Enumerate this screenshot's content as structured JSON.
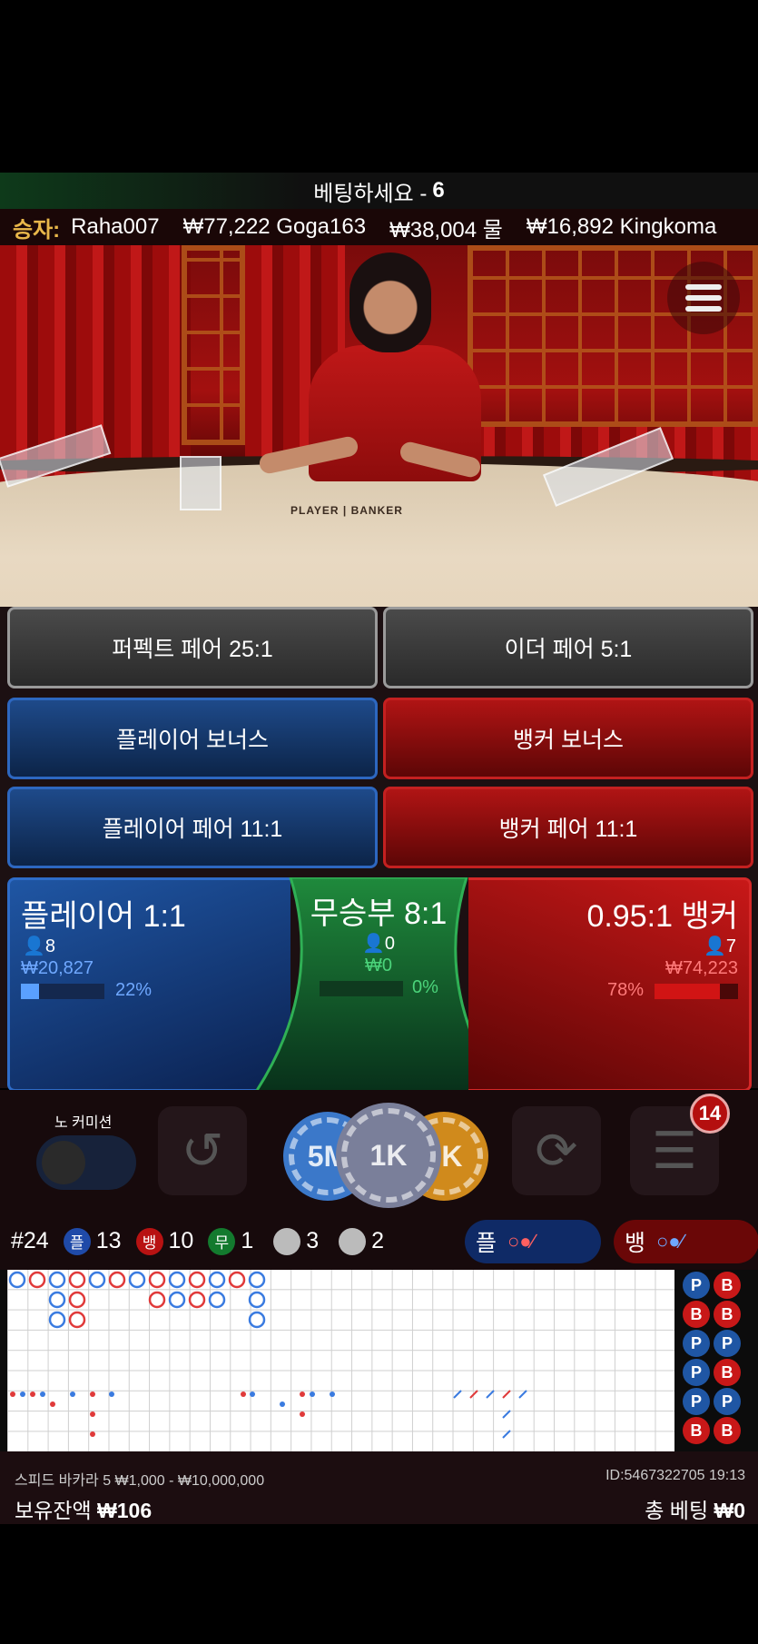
{
  "status": {
    "text": "베팅하세요 -",
    "count": "6"
  },
  "winners": {
    "label": "승자:",
    "items": [
      "Raha007",
      "₩77,222 Goga163",
      "₩38,004 물",
      "₩16,892 Kingkoma"
    ]
  },
  "video": {
    "table_text": "PLAYER | BANKER"
  },
  "side_bets": {
    "perfect_pair": "퍼펙트 페어 25:1",
    "either_pair": "이더 페어 5:1",
    "player_bonus": "플레이어 보너스",
    "banker_bonus": "뱅커 보너스",
    "player_pair": "플레이어 페어 11:1",
    "banker_pair": "뱅커 페어 11:1"
  },
  "main_bets": {
    "player": {
      "title": "플레이어 1:1",
      "players": "8",
      "amount": "₩20,827",
      "percent_label": "22%",
      "percent": 22
    },
    "tie": {
      "title": "무승부 8:1",
      "players": "0",
      "amount": "₩0",
      "percent_label": "0%",
      "percent": 0
    },
    "banker": {
      "title": "0.95:1 뱅커",
      "players": "7",
      "amount": "₩74,223",
      "percent_label": "78%",
      "percent": 78
    }
  },
  "controls": {
    "no_commission_label": "노 커미션",
    "chips": [
      "5M",
      "1K",
      "5K"
    ],
    "bet_history_count": "14"
  },
  "stats": {
    "round": "#24",
    "player_letter": "플",
    "player_wins": "13",
    "banker_letter": "뱅",
    "banker_wins": "10",
    "tie_letter": "무",
    "tie_wins": "1",
    "player_pairs": "3",
    "banker_pairs": "2",
    "player_predict_label": "플",
    "banker_predict_label": "뱅"
  },
  "beads": [
    "P",
    "B",
    "B",
    "B",
    "P",
    "P",
    "P",
    "B",
    "P",
    "P",
    "B",
    "B"
  ],
  "footer": {
    "game_info": "스피드 바카라 5 ₩1,000 - ₩10,000,000",
    "id_time": "ID:5467322705 19:13",
    "balance_label": "보유잔액",
    "balance": "₩106",
    "total_bet_label": "총 베팅",
    "total_bet": "₩0"
  },
  "colors": {
    "player": "#1f56a4",
    "banker": "#c81818",
    "tie": "#1b7a35",
    "gold": "#e8b74a"
  }
}
